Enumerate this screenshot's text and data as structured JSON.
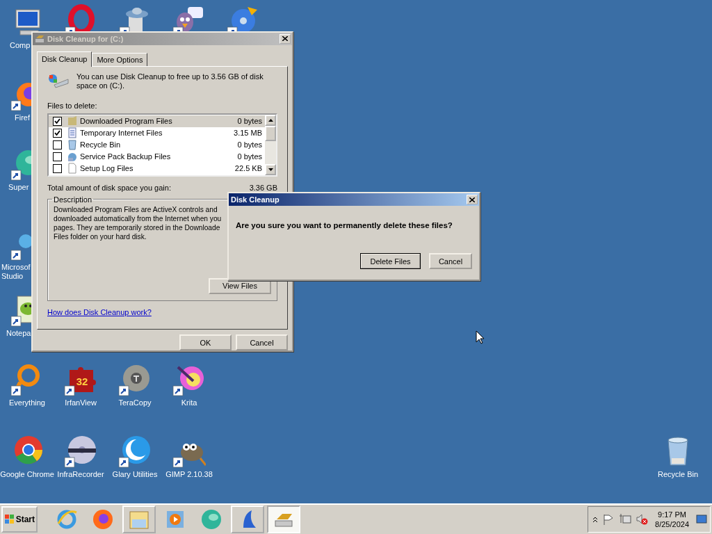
{
  "desktop": {
    "icons": [
      {
        "kind": "computer",
        "label_lines": [
          "Comp"
        ],
        "shortcut": false
      },
      {
        "kind": "opera",
        "shortcut": true
      },
      {
        "kind": "ufo",
        "shortcut": true
      },
      {
        "kind": "pidgin",
        "shortcut": true
      },
      {
        "kind": "cd",
        "shortcut": true
      },
      {
        "kind": "firefox",
        "label_lines": [
          "Firef"
        ],
        "shortcut": true
      },
      {
        "kind": "sphere",
        "label_lines": [
          "Super"
        ],
        "shortcut": true
      },
      {
        "kind": "studio",
        "label_lines": [
          "Microsof",
          "Studio"
        ],
        "shortcut": true
      },
      {
        "kind": "notepad",
        "label_lines": [
          "Notepa"
        ],
        "shortcut": true
      },
      {
        "kind": "everything",
        "label_lines": [
          "Everything"
        ],
        "shortcut": true
      },
      {
        "kind": "irfanview",
        "label_lines": [
          "IrfanView"
        ],
        "shortcut": true,
        "badge": "32"
      },
      {
        "kind": "teracopy",
        "label_lines": [
          "TeraCopy"
        ],
        "shortcut": true
      },
      {
        "kind": "krita",
        "label_lines": [
          "Krita"
        ],
        "shortcut": true
      },
      {
        "kind": "chrome",
        "label_lines": [
          "Google Chrome"
        ],
        "shortcut": false
      },
      {
        "kind": "infrarecorder",
        "label_lines": [
          "InfraRecorder"
        ],
        "shortcut": true
      },
      {
        "kind": "glary",
        "label_lines": [
          "Glary Utilities"
        ],
        "shortcut": true
      },
      {
        "kind": "gimp",
        "label_lines": [
          "GIMP 2.10.38"
        ],
        "shortcut": true
      },
      {
        "kind": "recycle",
        "label_lines": [
          "Recycle Bin"
        ],
        "shortcut": false
      }
    ]
  },
  "cleanup_window": {
    "title": "Disk Cleanup for  (C:)",
    "tabs": [
      {
        "label": "Disk Cleanup",
        "selected": true
      },
      {
        "label": "More Options",
        "selected": false
      }
    ],
    "intro": "You can use Disk Cleanup to free up to 3.56 GB of disk space on  (C:).",
    "files_label": "Files to delete:",
    "files": [
      {
        "name": "Downloaded Program Files",
        "size": "0 bytes",
        "checked": true,
        "selected": true
      },
      {
        "name": "Temporary Internet Files",
        "size": "3.15 MB",
        "checked": true,
        "selected": false
      },
      {
        "name": "Recycle Bin",
        "size": "0 bytes",
        "checked": false,
        "selected": false
      },
      {
        "name": "Service Pack Backup Files",
        "size": "0 bytes",
        "checked": false,
        "selected": false
      },
      {
        "name": "Setup Log Files",
        "size": "22.5 KB",
        "checked": false,
        "selected": false
      }
    ],
    "total_label": "Total amount of disk space you gain:",
    "total_value": "3.36 GB",
    "description": {
      "legend": "Description",
      "lines": [
        "Downloaded Program Files are ActiveX controls and",
        "downloaded automatically from the Internet when you",
        "pages. They are temporarily stored in the Downloade",
        "Files folder on your hard disk."
      ],
      "button": "View Files"
    },
    "help_link": "How does Disk Cleanup work?",
    "buttons": [
      "OK",
      "Cancel"
    ]
  },
  "confirm_dialog": {
    "title": "Disk Cleanup",
    "message": "Are you sure you want to permanently delete these files?",
    "buttons": [
      {
        "label": "Delete Files",
        "default": true
      },
      {
        "label": "Cancel",
        "default": false
      }
    ]
  },
  "taskbar": {
    "start": "Start",
    "tasks": [
      {
        "selected": false
      },
      {
        "selected": false
      },
      {
        "selected": true
      }
    ],
    "time": "9:17 PM",
    "date": "8/25/2024"
  }
}
